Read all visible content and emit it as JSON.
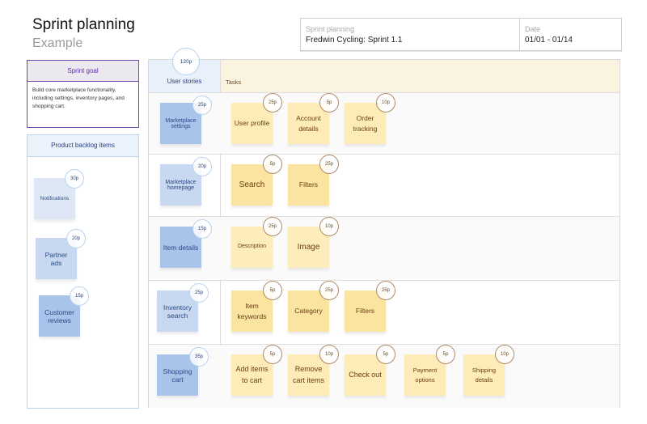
{
  "header": {
    "title": "Sprint planning",
    "subtitle": "Example",
    "info": {
      "project_label": "Sprint planning",
      "project_value": "Fredwin Cycling: Sprint 1.1",
      "date_label": "Date",
      "date_value": "01/01 - 01/14"
    }
  },
  "sprint_goal": {
    "heading": "Sprint goal",
    "text": "Build core marketplace functionality, including settings, inventory pages, and shopping cart."
  },
  "backlog": {
    "heading": "Product backlog items",
    "items": [
      {
        "label": "Notifications",
        "points": "30p",
        "color": "#dde7f5"
      },
      {
        "label": "Partner ads",
        "points": "20p",
        "color": "#c7d8f0"
      },
      {
        "label": "Customer reviews",
        "points": "15p",
        "color": "#a9c4ea"
      }
    ]
  },
  "board": {
    "user_stories_header": "User stories",
    "total_points": "120p",
    "tasks_header": "Tasks",
    "rows": [
      {
        "story": {
          "label": "Marketplace settings",
          "points": "25p",
          "color": "#a9c4ea"
        },
        "tasks": [
          {
            "label": "User profile",
            "points": "25p",
            "color": "#fdebb8"
          },
          {
            "label": "Account details",
            "points": "5p",
            "color": "#fdebb8"
          },
          {
            "label": "Order tracking",
            "points": "10p",
            "color": "#fdebb8"
          }
        ]
      },
      {
        "story": {
          "label": "Marketplace homepage",
          "points": "20p",
          "color": "#c7d8f0"
        },
        "tasks": [
          {
            "label": "Search",
            "points": "5p",
            "color": "#fae4a0"
          },
          {
            "label": "Filters",
            "points": "25p",
            "color": "#fae4a0"
          }
        ]
      },
      {
        "story": {
          "label": "Item details",
          "points": "15p",
          "color": "#a9c4ea"
        },
        "tasks": [
          {
            "label": "Description",
            "points": "25p",
            "color": "#fdecbc"
          },
          {
            "label": "Image",
            "points": "10p",
            "color": "#fdecbc"
          }
        ]
      },
      {
        "story": {
          "label": "Inventory search",
          "points": "25p",
          "color": "#c7d8f0"
        },
        "tasks": [
          {
            "label": "Item keywords",
            "points": "5p",
            "color": "#fae4a0"
          },
          {
            "label": "Category",
            "points": "25p",
            "color": "#fae4a0"
          },
          {
            "label": "Filters",
            "points": "25p",
            "color": "#fae4a0"
          }
        ]
      },
      {
        "story": {
          "label": "Shopping cart",
          "points": "35p",
          "color": "#a9c4ea"
        },
        "tasks": [
          {
            "label": "Add items to cart",
            "points": "5p",
            "color": "#fdebb8"
          },
          {
            "label": "Remove cart items",
            "points": "10p",
            "color": "#fdebb8"
          },
          {
            "label": "Check out",
            "points": "5p",
            "color": "#fdebb8"
          },
          {
            "label": "Payment options",
            "points": "5p",
            "color": "#fdebb8"
          },
          {
            "label": "Shipping details",
            "points": "10p",
            "color": "#fdebb8"
          }
        ]
      }
    ]
  }
}
